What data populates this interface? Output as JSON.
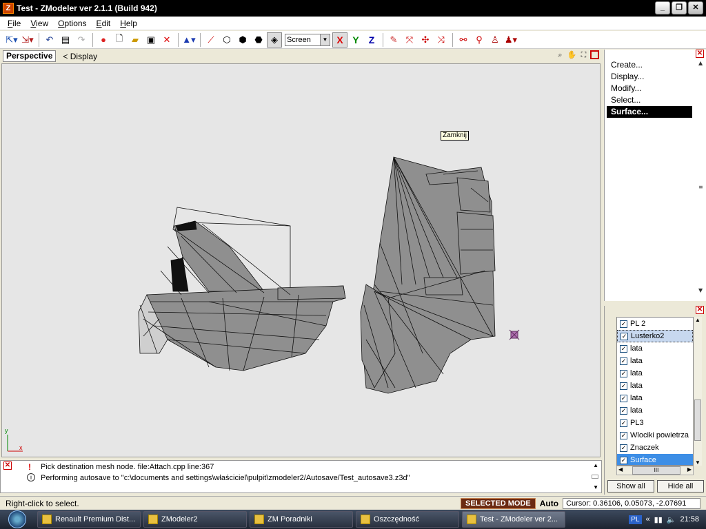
{
  "window": {
    "title": "Test - ZModeler ver 2.1.1 (Build 942)"
  },
  "menu": [
    {
      "label": "File",
      "accel": "F",
      "rest": "ile"
    },
    {
      "label": "View",
      "accel": "V",
      "rest": "iew"
    },
    {
      "label": "Options",
      "accel": "O",
      "rest": "ptions"
    },
    {
      "label": "Edit",
      "accel": "E",
      "rest": "dit"
    },
    {
      "label": "Help",
      "accel": "H",
      "rest": "elp"
    }
  ],
  "toolbar": {
    "coord_select": "Screen",
    "axis_x": "X",
    "axis_y": "Y",
    "axis_z": "Z"
  },
  "viewport": {
    "name": "Perspective",
    "display_label": "< Display",
    "tooltip": "Zamknij",
    "axis_y": "y",
    "axis_x": "x"
  },
  "right_menu": {
    "items": [
      "Create...",
      "Display...",
      "Modify...",
      "Select...",
      "Surface..."
    ],
    "active_index": 4
  },
  "object_list": {
    "items": [
      {
        "label": "PL 2",
        "checked": true,
        "state": "normal"
      },
      {
        "label": "Lusterko2",
        "checked": true,
        "state": "focused"
      },
      {
        "label": "lata",
        "checked": true,
        "state": "normal"
      },
      {
        "label": "lata",
        "checked": true,
        "state": "normal"
      },
      {
        "label": "lata",
        "checked": true,
        "state": "normal"
      },
      {
        "label": "lata",
        "checked": true,
        "state": "normal"
      },
      {
        "label": "lata",
        "checked": true,
        "state": "normal"
      },
      {
        "label": "lata",
        "checked": true,
        "state": "normal"
      },
      {
        "label": "PL3",
        "checked": true,
        "state": "normal"
      },
      {
        "label": "Wlociki powietrza",
        "checked": true,
        "state": "normal"
      },
      {
        "label": "Znaczek",
        "checked": true,
        "state": "normal"
      },
      {
        "label": "Surface",
        "checked": true,
        "state": "selected"
      }
    ],
    "show_all": "Show all",
    "hide_all": "Hide all",
    "hscroll_thumb": "III"
  },
  "console": {
    "lines": [
      {
        "icon": "exclamation-icon",
        "text": "Pick destination mesh node. file:Attach.cpp line:367"
      },
      {
        "icon": "info-icon",
        "text": "Performing autosave to \"c:\\documents and settings\\właściciel\\pulpit\\zmodeler2/Autosave/Test_autosave3.z3d\""
      }
    ]
  },
  "status": {
    "hint": "Right-click to select.",
    "mode": "SELECTED MODE",
    "auto": "Auto",
    "cursor": "Cursor: 0.36106, 0.05073, -2.07691"
  },
  "taskbar": {
    "tasks": [
      {
        "label": "Renault Premium Dist...",
        "active": false
      },
      {
        "label": "ZModeler2",
        "active": false
      },
      {
        "label": "ZM Poradniki",
        "active": false
      },
      {
        "label": "Oszczędność",
        "active": false
      },
      {
        "label": "Test - ZModeler ver 2...",
        "active": true
      }
    ],
    "lang": "PL",
    "clock": "21:58"
  },
  "colors": {
    "mesh_fill": "#8f8f8f",
    "mesh_edge": "#111111",
    "selected_mode": "#6b2a12",
    "list_selected": "#3d8ee6"
  }
}
